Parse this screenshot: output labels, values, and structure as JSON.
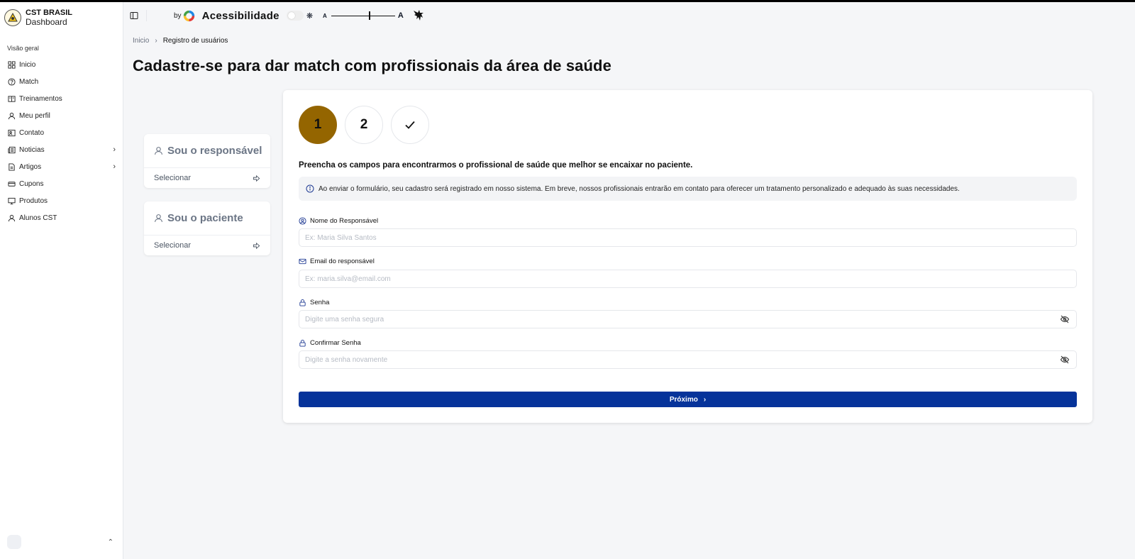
{
  "brand": {
    "title": "CST BRASIL",
    "subtitle": "Dashboard"
  },
  "sidebar": {
    "section": "Visão geral",
    "items": [
      {
        "label": "Inicio",
        "icon": "grid-icon"
      },
      {
        "label": "Match",
        "icon": "help-circle-icon"
      },
      {
        "label": "Treinamentos",
        "icon": "book-open-icon"
      },
      {
        "label": "Meu perfil",
        "icon": "user-icon"
      },
      {
        "label": "Contato",
        "icon": "contact-icon"
      },
      {
        "label": "Noticias",
        "icon": "newspaper-icon",
        "expandable": true
      },
      {
        "label": "Artigos",
        "icon": "file-text-icon",
        "expandable": true
      },
      {
        "label": "Cupons",
        "icon": "ticket-icon"
      },
      {
        "label": "Produtos",
        "icon": "monitor-icon"
      },
      {
        "label": "Alunos CST",
        "icon": "user-icon"
      }
    ]
  },
  "topbar": {
    "by_label": "by",
    "accessibility_title": "Acessibilidade",
    "font_small": "A",
    "font_large": "A",
    "font_slider_value": 0.6
  },
  "breadcrumb": {
    "home": "Inicio",
    "current": "Registro de usuários"
  },
  "page_title": "Cadastre-se para dar match com profissionais da área de saúde",
  "choices": [
    {
      "title": "Sou o responsável",
      "action": "Selecionar"
    },
    {
      "title": "Sou o paciente",
      "action": "Selecionar"
    }
  ],
  "steps": [
    {
      "label": "1",
      "state": "active"
    },
    {
      "label": "2",
      "state": "pending"
    },
    {
      "label": "✓",
      "state": "pending"
    }
  ],
  "form": {
    "description": "Preencha os campos para encontrarmos o profissional de saúde que melhor se encaixar no paciente.",
    "info": "Ao enviar o formulário, seu cadastro será registrado em nosso sistema. Em breve, nossos profissionais entrarão em contato para oferecer um tratamento personalizado e adequado às suas necessidades.",
    "fields": [
      {
        "label": "Nome do Responsável",
        "placeholder": "Ex: Maria Silva Santos",
        "value": ""
      },
      {
        "label": "Email do responsável",
        "placeholder": "Ex: maria.silva@email.com",
        "value": ""
      },
      {
        "label": "Senha",
        "placeholder": "Digite uma senha segura",
        "value": ""
      },
      {
        "label": "Confirmar Senha",
        "placeholder": "Digite a senha novamente",
        "value": ""
      }
    ],
    "submit_label": "Próximo"
  },
  "colors": {
    "accent_step": "#946500",
    "primary_button": "#06339a"
  }
}
